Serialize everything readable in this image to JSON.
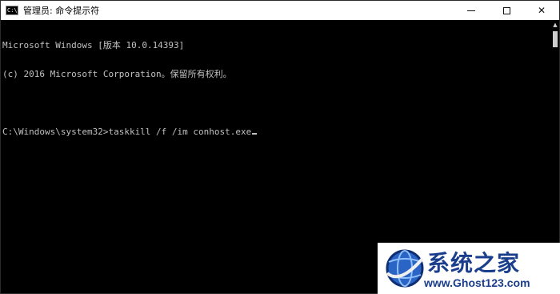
{
  "window": {
    "title": "管理员: 命令提示符",
    "icon": "cmd-icon",
    "icon_text": "C:\\",
    "controls": {
      "minimize": "minimize-icon",
      "maximize": "maximize-icon",
      "close": "✕"
    }
  },
  "console": {
    "lines": [
      "Microsoft Windows [版本 10.0.14393]",
      "(c) 2016 Microsoft Corporation。保留所有权利。",
      "",
      "C:\\Windows\\system32>taskkill /f /im conhost.exe"
    ],
    "colors": {
      "background": "#000000",
      "text": "#c0c0c0"
    }
  },
  "scrollbar": {
    "up_arrow": "▲"
  },
  "watermark": {
    "name": "系统之家",
    "url": "www.Ghost123.com",
    "brand_color": "#1a3e8c"
  }
}
